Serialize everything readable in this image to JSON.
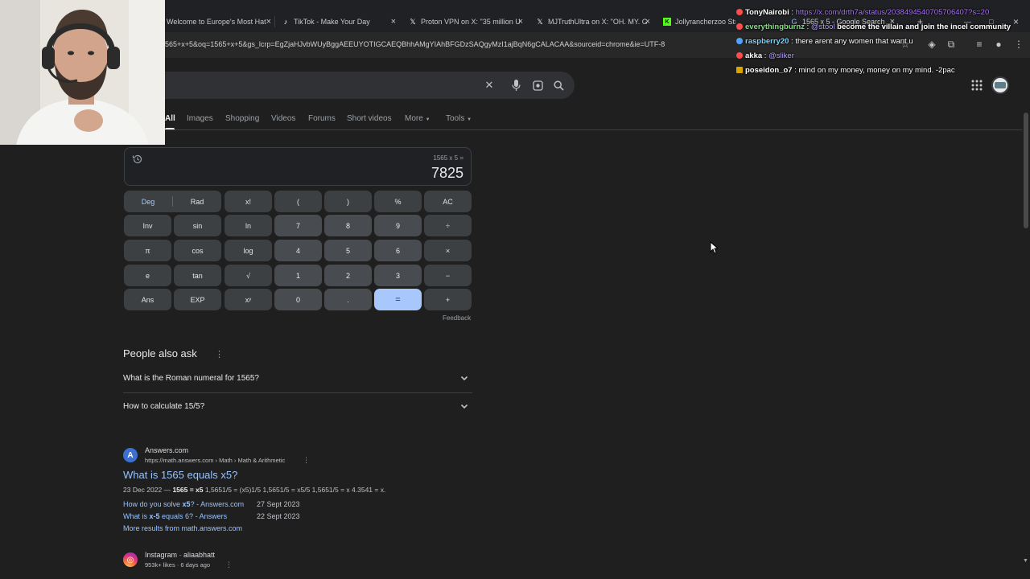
{
  "browser": {
    "tabs": [
      {
        "label": "Welcome to Europe's Most Hat",
        "icon": "globe-icon"
      },
      {
        "label": "TikTok - Make Your Day",
        "icon": "tiktok-icon"
      },
      {
        "label": "Proton VPN on X: \"35 million U",
        "icon": "x-icon"
      },
      {
        "label": "MJTruthUltra on X: \"OH. MY. G",
        "icon": "x-icon"
      },
      {
        "label": "Jollyrancherzoo Stream - Watc",
        "icon": "kick-icon"
      },
      {
        "label": "1565 x 5 - Google Search",
        "icon": "google-icon"
      }
    ],
    "url": "565+x+5&oq=1565+x+5&gs_lcrp=EgZjaHJvbWUyBggAEEUYOTIGCAEQBhhAMgYIAhBFGDzSAQgyMzI1ajBqN6gCALACAA&sourceid=chrome&ie=UTF-8"
  },
  "search": {
    "nav_tabs": [
      "All",
      "Images",
      "Shopping",
      "Videos",
      "Forums",
      "Short videos",
      "More",
      "Tools"
    ]
  },
  "calculator": {
    "expression": "1565 x 5 =",
    "result": "7825",
    "keys": {
      "deg": "Deg",
      "rad": "Rad",
      "fact": "x!",
      "lparen": "(",
      "rparen": ")",
      "percent": "%",
      "ac": "AC",
      "inv": "Inv",
      "sin": "sin",
      "ln": "ln",
      "seven": "7",
      "eight": "8",
      "nine": "9",
      "divide": "÷",
      "pi": "π",
      "cos": "cos",
      "log": "log",
      "four": "4",
      "five": "5",
      "six": "6",
      "multiply": "×",
      "e": "e",
      "tan": "tan",
      "sqrt": "√",
      "one": "1",
      "two": "2",
      "three": "3",
      "minus": "−",
      "ans": "Ans",
      "exp": "EXP",
      "pow": "xʸ",
      "zero": "0",
      "dot": ".",
      "equals": "=",
      "plus": "+"
    },
    "feedback": "Feedback"
  },
  "people_also_ask": {
    "title": "People also ask",
    "questions": [
      "What is the Roman numeral for 1565?",
      "How to calculate 15/5?"
    ]
  },
  "results": [
    {
      "site": "Answers.com",
      "url": "https://math.answers.com › Math › Math & Arithmetic",
      "title": "What is 1565 equals x5?",
      "date": "23 Dec 2022",
      "snippet_bold": "1565 = x5",
      "snippet_rest": " 1,5651/5 = (x5)1/5 1,5651/5 = x5/5 1,5651/5 = x 4.3541 = x.",
      "sublinks": [
        {
          "pre": "How do you solve ",
          "bold": "x5",
          "post": "? - Answers.com",
          "date": "27 Sept 2023"
        },
        {
          "pre": "What is ",
          "bold": "x-5",
          "post": " equals 6? - Answers",
          "date": "22 Sept 2023"
        }
      ],
      "more": "More results from math.answers.com"
    },
    {
      "site": "Instagram · aliaabhatt",
      "meta": "953k+ likes · 6 days ago"
    }
  ],
  "chat": [
    {
      "user": "TonyNairobi",
      "sep": " : ",
      "msg": "https://x.com/drth7a/status/2038494540705706407?s=20",
      "user_color": "#ffffff",
      "badge_color": "#ff4d4d",
      "msg_type": "link"
    },
    {
      "user": "everythingburnz",
      "sep": " : ",
      "mention": "@stool",
      "msg": " become the villain and join the incel community",
      "user_color": "#7fe07f",
      "badge_color": "#ff4d4d"
    },
    {
      "user": "raspberry20",
      "sep": " : ",
      "msg": "there arent any women that want u",
      "user_color": "#7fd4ff",
      "badge_color": "#4ea4ff"
    },
    {
      "user": "akka",
      "sep": " : ",
      "mention": "@sliker",
      "msg": "",
      "user_color": "#ffffff",
      "badge_color": "#ff4d4d"
    },
    {
      "user": "poseidon_o7",
      "sep": " : ",
      "msg": "mind on my money, money on my mind. -2pac",
      "user_color": "#ffffff",
      "badge_color": "#d9a400"
    }
  ]
}
